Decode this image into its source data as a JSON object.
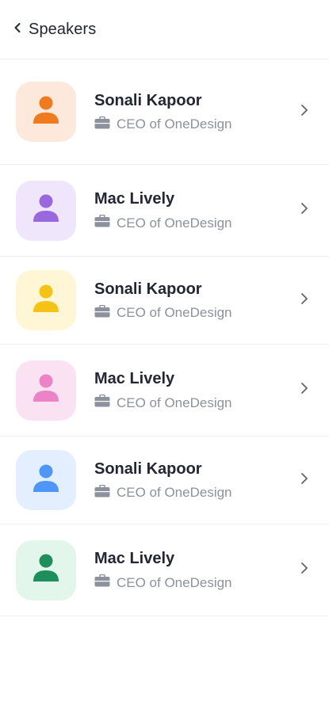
{
  "header": {
    "title": "Speakers"
  },
  "speakers": [
    {
      "name": "Sonali Kapoor",
      "role": "CEO of OneDesign",
      "bg": "#fde9dc",
      "fg": "#f07a1e",
      "icon": "person-icon"
    },
    {
      "name": "Mac Lively",
      "role": "CEO of OneDesign",
      "bg": "#efe6fb",
      "fg": "#9a68dd",
      "icon": "person-icon"
    },
    {
      "name": "Sonali Kapoor",
      "role": "CEO of OneDesign",
      "bg": "#fff6d6",
      "fg": "#f5c313",
      "icon": "person-icon"
    },
    {
      "name": "Mac Lively",
      "role": "CEO of OneDesign",
      "bg": "#fbe2f2",
      "fg": "#ec83c7",
      "icon": "person-icon"
    },
    {
      "name": "Sonali Kapoor",
      "role": "CEO of OneDesign",
      "bg": "#e3efff",
      "fg": "#4f97f7",
      "icon": "person-icon"
    },
    {
      "name": "Mac Lively",
      "role": "CEO of OneDesign",
      "bg": "#e3f6ec",
      "fg": "#1e8f5c",
      "icon": "person-icon"
    }
  ],
  "colors": {
    "text": "#232735",
    "muted": "#8c919d",
    "divider": "#eceef2"
  }
}
